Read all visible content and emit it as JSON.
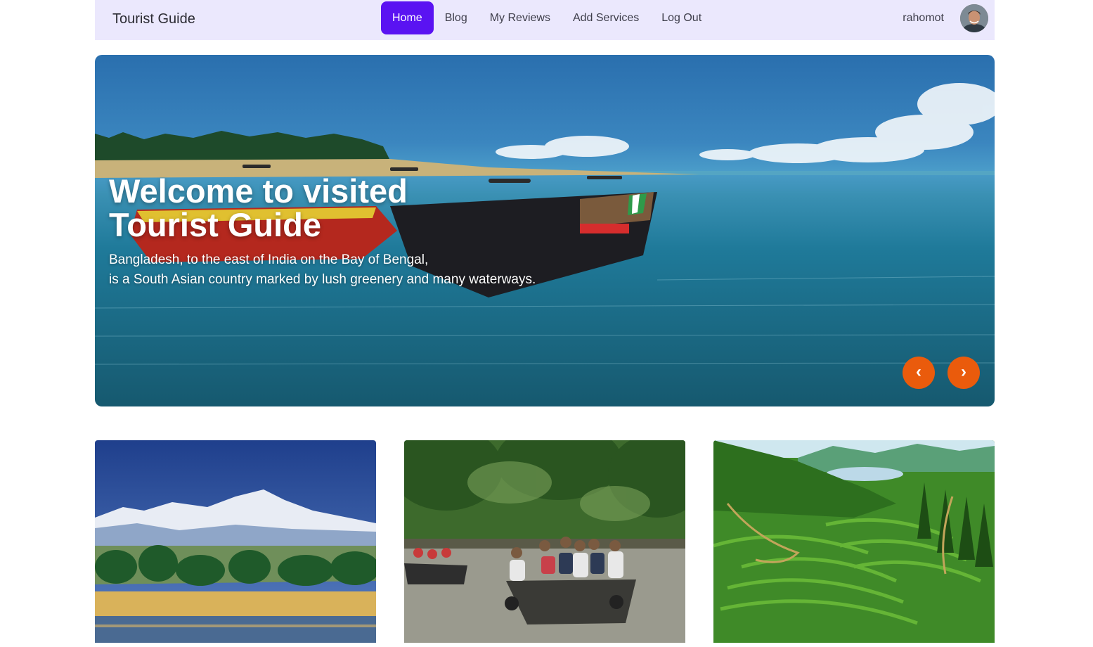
{
  "navbar": {
    "brand": "Tourist Guide",
    "links": [
      {
        "label": "Home",
        "active": true
      },
      {
        "label": "Blog",
        "active": false
      },
      {
        "label": "My Reviews",
        "active": false
      },
      {
        "label": "Add Services",
        "active": false
      },
      {
        "label": "Log Out",
        "active": false
      }
    ],
    "user_name": "rahomot",
    "avatar_icon": "user-avatar"
  },
  "hero": {
    "title": "Welcome to visited Tourist Guide",
    "subtitle_line1": "Bangladesh, to the east of India on the Bay of Bengal,",
    "subtitle_line2": "is a South Asian country marked by lush greenery and many waterways.",
    "prev_label": "‹",
    "next_label": "›"
  },
  "cards": [
    {
      "image": "snow-mountain-river"
    },
    {
      "image": "boat-forest-river"
    },
    {
      "image": "tea-garden-hills"
    }
  ],
  "colors": {
    "nav_bg": "#ebe8fd",
    "active_link": "#5a13f2",
    "arrow_button": "#ea5b0c"
  }
}
